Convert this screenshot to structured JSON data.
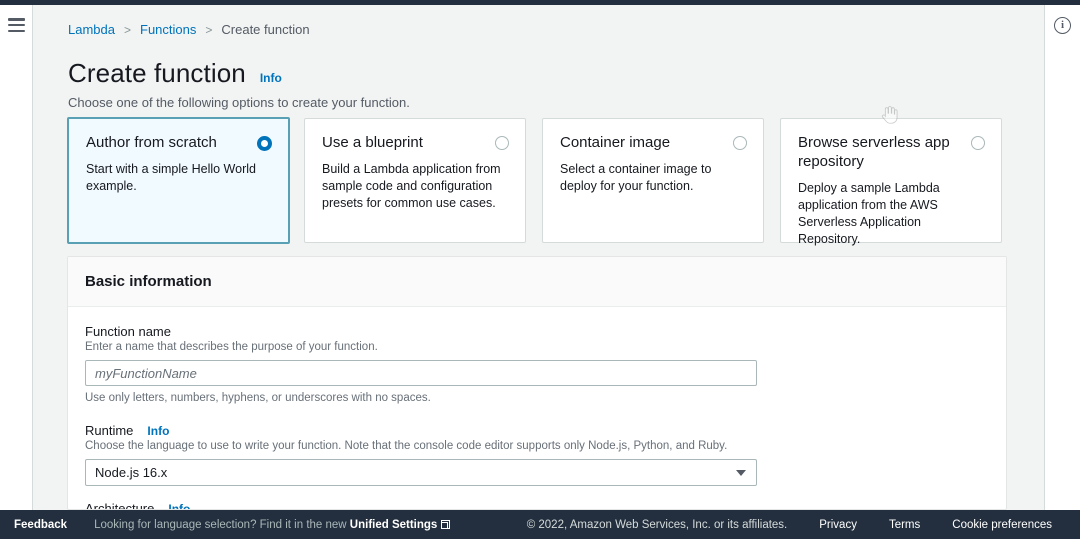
{
  "breadcrumb": {
    "items": [
      {
        "label": "Lambda",
        "link": true
      },
      {
        "label": "Functions",
        "link": true
      },
      {
        "label": "Create function",
        "link": false
      }
    ],
    "separator": ">"
  },
  "header": {
    "title": "Create function",
    "info_label": "Info",
    "subtitle": "Choose one of the following options to create your function."
  },
  "options": [
    {
      "title": "Author from scratch",
      "description": "Start with a simple Hello World example.",
      "selected": true
    },
    {
      "title": "Use a blueprint",
      "description": "Build a Lambda application from sample code and configuration presets for common use cases.",
      "selected": false
    },
    {
      "title": "Container image",
      "description": "Select a container image to deploy for your function.",
      "selected": false
    },
    {
      "title": "Browse serverless app repository",
      "description": "Deploy a sample Lambda application from the AWS Serverless Application Repository.",
      "selected": false
    }
  ],
  "basic_information": {
    "panel_title": "Basic information",
    "function_name": {
      "label": "Function name",
      "hint": "Enter a name that describes the purpose of your function.",
      "placeholder": "myFunctionName",
      "value": "",
      "constraint": "Use only letters, numbers, hyphens, or underscores with no spaces."
    },
    "runtime": {
      "label": "Runtime",
      "info_label": "Info",
      "hint": "Choose the language to use to write your function. Note that the console code editor supports only Node.js, Python, and Ruby.",
      "value": "Node.js 16.x"
    },
    "architecture": {
      "label": "Architecture",
      "info_label": "Info"
    }
  },
  "footer": {
    "feedback": "Feedback",
    "language_note_prefix": "Looking for language selection? Find it in the new ",
    "language_note_link": "Unified Settings",
    "copyright": "© 2022, Amazon Web Services, Inc. or its affiliates.",
    "links": [
      "Privacy",
      "Terms",
      "Cookie preferences"
    ]
  },
  "colors": {
    "accent_link": "#0073bb",
    "selected_card_bg": "#f1faff",
    "selected_card_border": "#5aa0b4",
    "footer_bg": "#232f3e",
    "page_bg": "#f2f3f3"
  }
}
